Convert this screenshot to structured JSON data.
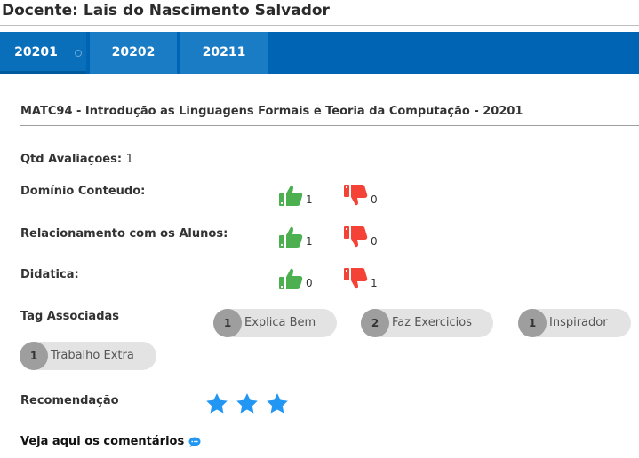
{
  "header": {
    "title": "Docente: Lais do Nascimento Salvador"
  },
  "tabs": [
    {
      "label": "20201",
      "active": true
    },
    {
      "label": "20202",
      "active": false
    },
    {
      "label": "20211",
      "active": false
    }
  ],
  "course": {
    "title": "MATC94 - Introdução as Linguagens Formais e Teoria da Computação - 20201"
  },
  "qtd": {
    "label": "Qtd Avaliações:",
    "value": "1"
  },
  "criteria": [
    {
      "label": "Domínio Conteudo:",
      "up": "1",
      "down": "0"
    },
    {
      "label": "Relacionamento com os Alunos:",
      "up": "1",
      "down": "0"
    },
    {
      "label": "Didatica:",
      "up": "0",
      "down": "1"
    }
  ],
  "tags": {
    "label": "Tag Associadas",
    "items": [
      {
        "count": "1",
        "label": "Explica Bem"
      },
      {
        "count": "2",
        "label": "Faz Exercicios"
      },
      {
        "count": "1",
        "label": "Inspirador"
      },
      {
        "count": "1",
        "label": "Trabalho Extra"
      }
    ]
  },
  "recommendation": {
    "label": "Recomendação",
    "stars": 3
  },
  "comments": {
    "label": "Veja aqui os comentários"
  },
  "colors": {
    "tab_bar": "#0064b4",
    "tab": "#1a7cc4",
    "thumb_up": "#4caf50",
    "thumb_down": "#f44336",
    "star": "#2196f3"
  },
  "icons": {
    "up": "thumb-up-icon",
    "down": "thumb-down-icon",
    "star": "star-icon",
    "comments": "chat-bubble-icon"
  }
}
